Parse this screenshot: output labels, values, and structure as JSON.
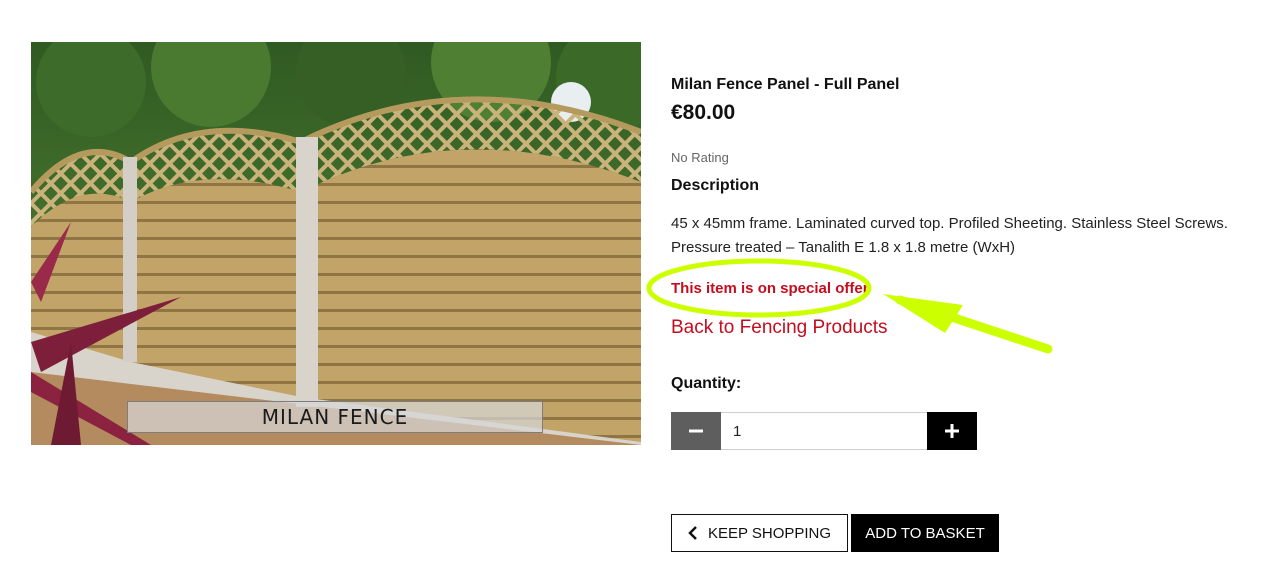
{
  "product": {
    "image_caption": "MILAN FENCE",
    "title": "Milan Fence Panel - Full Panel",
    "price": "€80.00",
    "rating": "No Rating",
    "description_heading": "Description",
    "description_text": "45 x 45mm frame. Laminated curved top. Profiled Sheeting. Stainless Steel Screws. Pressure treated – Tanalith E 1.8 x 1.8 metre (WxH)",
    "offer_text": "This item is on special offer",
    "back_link": "Back to Fencing Products"
  },
  "quantity": {
    "label": "Quantity:",
    "value": "1",
    "minus_icon": "minus-icon",
    "plus_icon": "plus-icon"
  },
  "actions": {
    "keep_shopping": "KEEP SHOPPING",
    "add_to_basket": "ADD TO BASKET"
  },
  "colors": {
    "accent_red": "#c40d1e",
    "annotation_green": "#ccff00",
    "button_dark": "#000000",
    "minus_button": "#5e5e5e"
  }
}
